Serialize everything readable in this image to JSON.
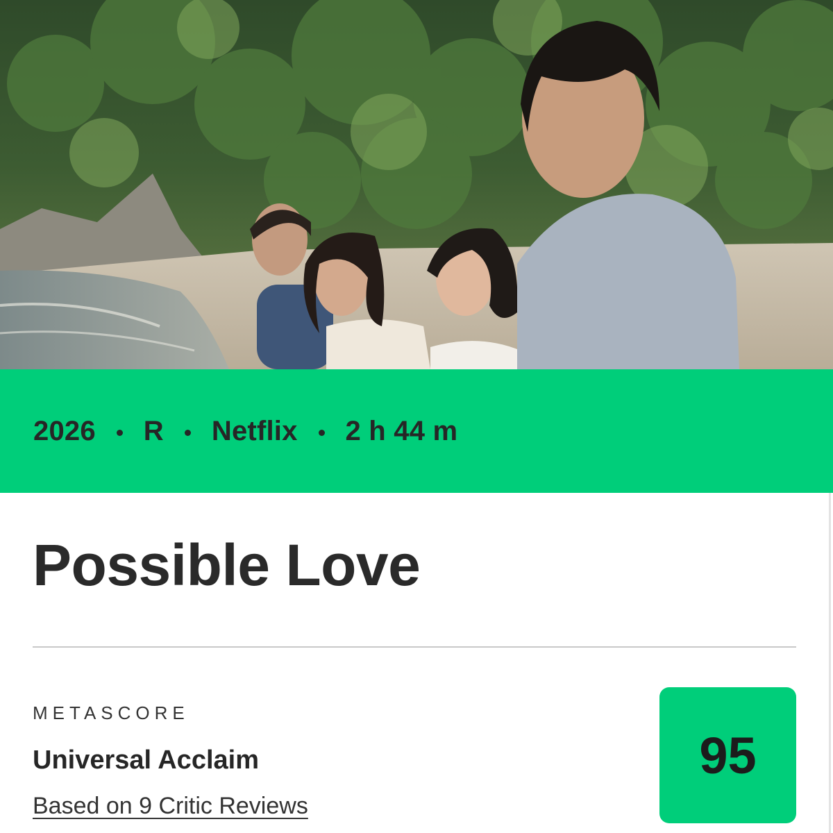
{
  "hero": {
    "image": "Four people standing on a sandy beach by the sea in front of a forested hillside"
  },
  "meta": {
    "year": "2026",
    "rating": "R",
    "platform": "Netflix",
    "runtime": "2 h 44 m"
  },
  "title": "Possible Love",
  "metascore": {
    "label": "METASCORE",
    "verdict": "Universal Acclaim",
    "reviews_link": "Based on 9 Critic Reviews",
    "score": "95"
  },
  "colors": {
    "accent_green": "#00ce7a",
    "text_dark": "#2b2b2b"
  }
}
